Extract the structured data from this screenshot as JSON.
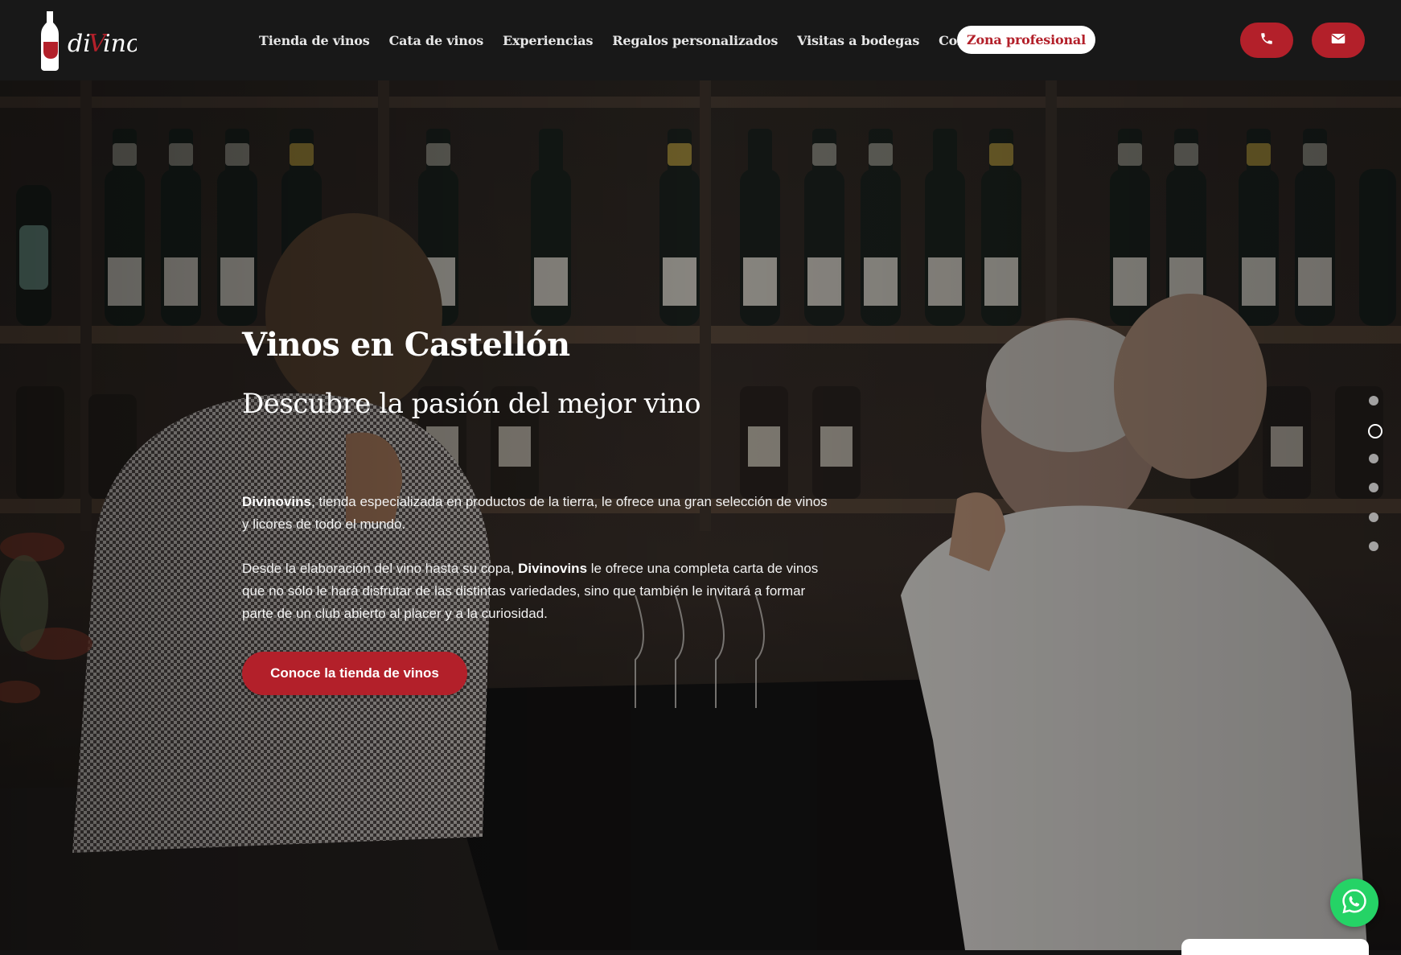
{
  "brand": {
    "logo_text": "diVino"
  },
  "nav": {
    "items": [
      {
        "label": "Tienda de vinos"
      },
      {
        "label": "Cata de vinos"
      },
      {
        "label": "Experiencias"
      },
      {
        "label": "Regalos personalizados"
      },
      {
        "label": "Visitas a bodegas"
      },
      {
        "label": "Contacto"
      }
    ],
    "pro_zone": "Zona profesional"
  },
  "header_actions": {
    "phone_icon": "phone-icon",
    "mail_icon": "envelope-icon"
  },
  "hero": {
    "title": "Vinos en Castellón",
    "subtitle": "Descubre la pasión del mejor vino",
    "p1_brand": "Divinovins",
    "p1_rest": ", tienda especializada en productos de la tierra, le ofrece una gran selección de vinos y licores de todo el mundo.",
    "p2_start": "Desde la elaboración del vino hasta su copa, ",
    "p2_brand": "Divinovins",
    "p2_rest": " le ofrece una completa carta de vinos  que no sólo le hará disfrutar de las distintas variedades, sino que también le invitará a formar parte de un club abierto al placer y a la curiosidad.",
    "cta": "Conoce la tienda de vinos"
  },
  "slider": {
    "dot_count": 6,
    "active_index": 1
  },
  "colors": {
    "accent": "#b3202a",
    "header_bg": "#181818",
    "whatsapp": "#25d366"
  }
}
